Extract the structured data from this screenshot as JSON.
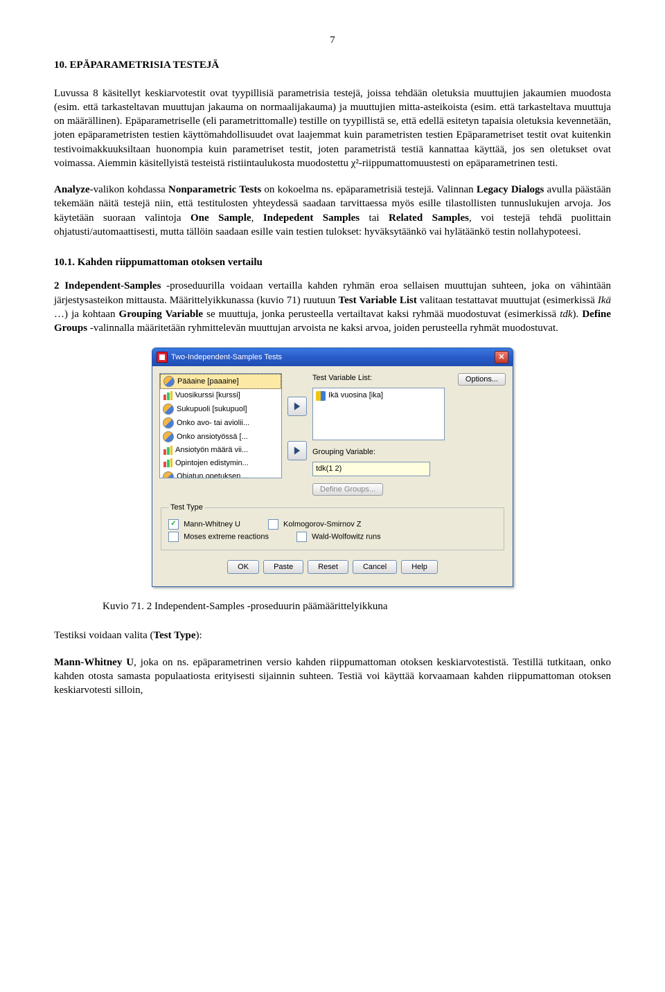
{
  "page_number": "7",
  "heading": "10. EPÄPARAMETRISIA TESTEJÄ",
  "para1": "Luvussa 8 käsitellyt keskiarvotestit ovat tyypillisiä parametrisia testejä, joissa tehdään oletuksia muuttujien jakaumien muodosta (esim. että tarkasteltavan muuttujan jakauma on normaalijakauma) ja muuttujien mitta-asteikoista (esim. että tarkasteltava muuttuja on määrällinen). Epäparametriselle (eli parametrittomalle) testille on tyypillistä se, että edellä esitetyn tapaisia oletuksia kevennetään, joten epäparametristen testien käyttömahdollisuudet ovat laajemmat kuin parametristen testien Epäparametriset testit ovat kuitenkin testivoimakkuuksiltaan huonompia kuin parametriset testit, joten parametristä testiä kannattaa käyttää, jos sen oletukset ovat voimassa. Aiemmin käsitellyistä testeistä ristiintaulukosta muodostettu χ²-riippumattomuustesti on epäparametrinen testi.",
  "para2_pre": "",
  "para2": "Analyze-valikon kohdassa Nonparametric Tests on kokoelma ns. epäparametrisiä testejä. Valinnan Legacy Dialogs avulla päästään tekemään näitä testejä niin, että testitulosten yhteydessä saadaan tarvittaessa myös esille tilastollisten tunnuslukujen arvoja. Jos käytetään suoraan valintoja One Sample, Indepedent Samples tai Related Samples, voi testejä tehdä puolittain ohjatusti/automaattisesti, mutta tällöin saadaan esille vain testien tulokset: hyväksytäänkö vai hylätäänkö testin nollahypoteesi.",
  "sect101_heading": "10.1. Kahden riippumattoman otoksen vertailu",
  "para3": "2 Independent-Samples -proseduurilla voidaan vertailla kahden ryhmän eroa sellaisen muuttujan suhteen, joka on vähintään järjestysasteikon mittausta. Määrittelyikkunassa (kuvio 71) ruutuun Test Variable List valitaan testattavat muuttujat (esimerkissä Ikä …) ja kohtaan Grouping Variable se muuttuja, jonka perusteella vertailtavat kaksi ryhmää muodostuvat (esimerkissä tdk). Define Groups -valinnalla määritetään ryhmittelevän muuttujan arvoista ne kaksi arvoa, joiden perusteella ryhmät muodostuvat.",
  "dialog": {
    "title": "Two-Independent-Samples Tests",
    "source_items": [
      {
        "icon": "nom",
        "label": "Pääaine [paaaine]",
        "selected": true
      },
      {
        "icon": "ord",
        "label": "Vuosikurssi [kurssi]"
      },
      {
        "icon": "nom",
        "label": "Sukupuoli [sukupuol]"
      },
      {
        "icon": "nom",
        "label": "Onko avo- tai aviolii..."
      },
      {
        "icon": "nom",
        "label": "Onko ansiotyössä [..."
      },
      {
        "icon": "ord",
        "label": "Ansiotyön määrä vii..."
      },
      {
        "icon": "ord",
        "label": "Opintojen edistymin..."
      },
      {
        "icon": "nom",
        "label": "Ohjatun opetuksen ..."
      }
    ],
    "labels": {
      "test_var_list": "Test Variable List:",
      "grouping_var": "Grouping Variable:",
      "define_groups": "Define Groups...",
      "options": "Options..."
    },
    "target_item": {
      "icon": "scale",
      "label": "Ikä vuosina [ika]"
    },
    "grouping_value": "tdk(1 2)",
    "test_type_legend": "Test Type",
    "checks": {
      "mw": {
        "label": "Mann-Whitney U",
        "checked": true
      },
      "ks": {
        "label": "Kolmogorov-Smirnov Z",
        "checked": false
      },
      "moses": {
        "label": "Moses extreme reactions",
        "checked": false
      },
      "ww": {
        "label": "Wald-Wolfowitz runs",
        "checked": false
      }
    },
    "buttons": {
      "ok": "OK",
      "paste": "Paste",
      "reset": "Reset",
      "cancel": "Cancel",
      "help": "Help"
    }
  },
  "fig_caption": "Kuvio 71. 2 Independent-Samples -proseduurin päämäärittelyikkuna",
  "para4": "Testiksi voidaan valita (Test Type):",
  "para5": "Mann-Whitney U, joka on ns. epäparametrinen versio kahden riippumattoman otoksen keskiarvotestistä. Testillä tutkitaan, onko kahden otosta samasta populaatiosta erityisesti sijainnin suhteen. Testiä voi käyttää korvaamaan kahden riippumattoman otoksen keskiarvotesti silloin,"
}
